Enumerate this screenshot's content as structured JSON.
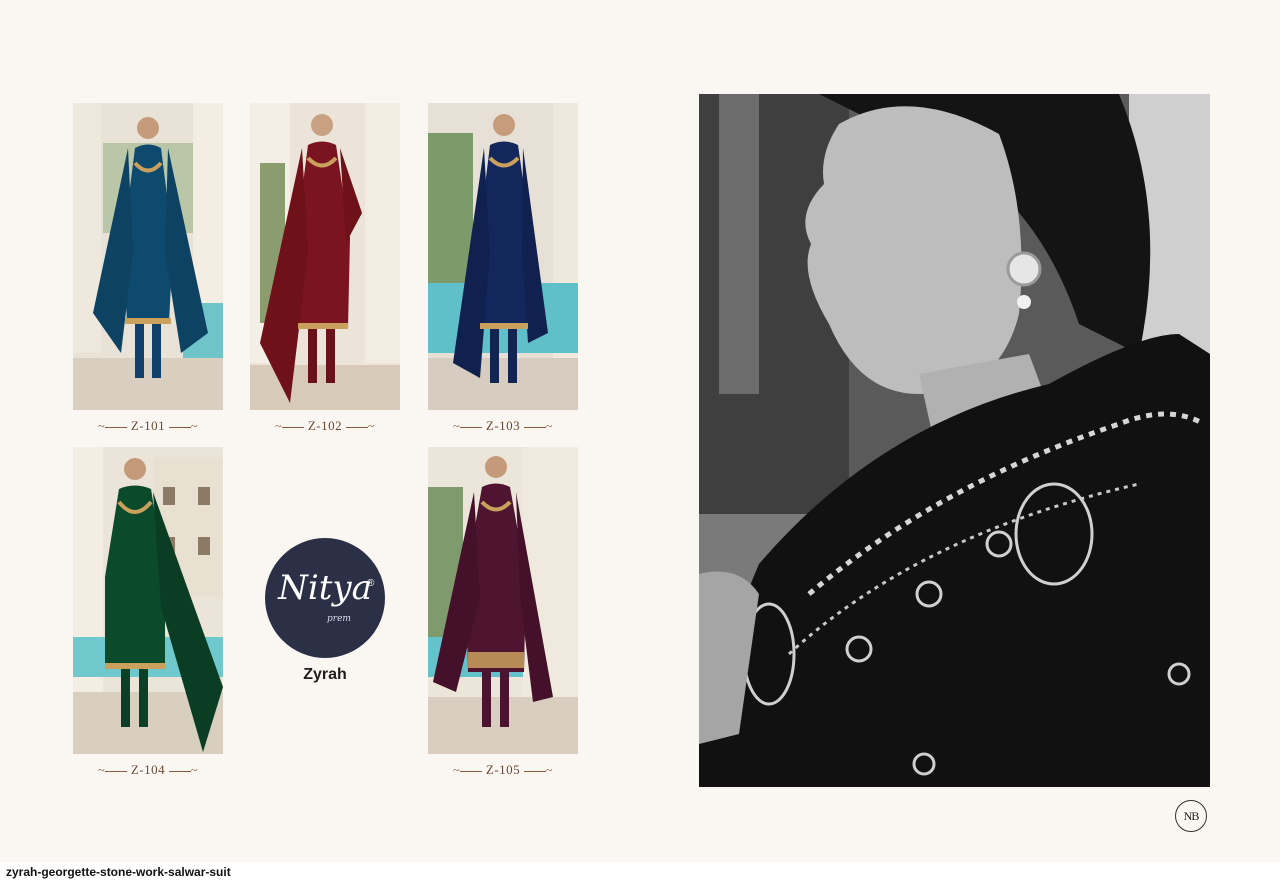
{
  "catalog": {
    "collection_name": "Zyrah",
    "brand_logo_text": "Nitya",
    "brand_logo_sub": "prem",
    "brand_logo_mark": "®",
    "monogram": "NB"
  },
  "products": [
    {
      "code": "Z-101",
      "suit_color": "#0e4a6e"
    },
    {
      "code": "Z-102",
      "suit_color": "#7a1420"
    },
    {
      "code": "Z-103",
      "suit_color": "#14275c"
    },
    {
      "code": "Z-104",
      "suit_color": "#0c4a2c"
    },
    {
      "code": "Z-105",
      "suit_color": "#4e1430"
    }
  ],
  "footer": {
    "caption": "zyrah-georgette-stone-work-salwar-suit"
  }
}
